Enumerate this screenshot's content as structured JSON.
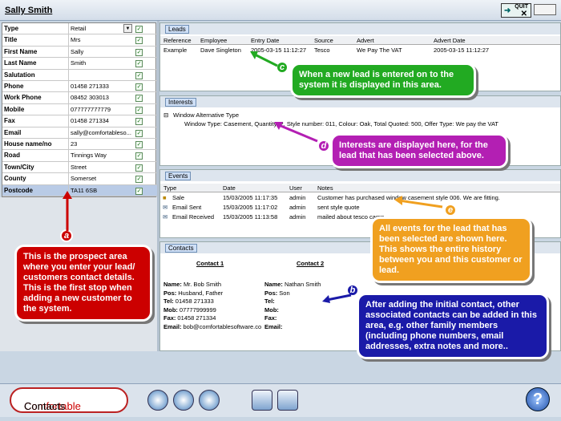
{
  "window": {
    "title": "Sally Smith",
    "quit_label": "QUIT"
  },
  "prospect": {
    "rows": [
      {
        "label": "Type",
        "value": "Retail",
        "dropdown": true
      },
      {
        "label": "Title",
        "value": "Mrs"
      },
      {
        "label": "First Name",
        "value": "Sally"
      },
      {
        "label": "Last Name",
        "value": "Smith"
      },
      {
        "label": "Salutation",
        "value": ""
      },
      {
        "label": "Phone",
        "value": "01458 271333"
      },
      {
        "label": "Work Phone",
        "value": "08452 303013"
      },
      {
        "label": "Mobile",
        "value": "077777777779"
      },
      {
        "label": "Fax",
        "value": "01458 271334"
      },
      {
        "label": "Email",
        "value": "sally@comfortableso..."
      },
      {
        "label": "House name/no",
        "value": "23"
      },
      {
        "label": "Road",
        "value": "Tinnings Way"
      },
      {
        "label": "Town/City",
        "value": "Street"
      },
      {
        "label": "County",
        "value": "Somerset"
      },
      {
        "label": "Postcode",
        "value": "TA11 6SB"
      }
    ]
  },
  "leads": {
    "tab": "Leads",
    "columns": [
      "Reference",
      "Employee",
      "Entry Date",
      "Source",
      "Advert",
      "Advert Date"
    ],
    "rows": [
      [
        "Example",
        "Dave Singleton",
        "2005-03-15 11:12:27",
        "Tesco",
        "We Pay The VAT",
        "2005-03-15 11:12:27"
      ]
    ]
  },
  "interests": {
    "tab": "Interests",
    "root": "Window Alternative Type",
    "child": "Window Type: Casement, Quantity: 2, Style number: 011, Colour: Oak, Total Quoted: 500, Offer Type: We pay the VAT"
  },
  "events": {
    "tab": "Events",
    "columns": [
      "Type",
      "Date",
      "User",
      "Notes"
    ],
    "rows": [
      [
        "Sale",
        "15/03/2005 11:17:35",
        "admin",
        "Customer has purchased window casement style 006. We are fitting."
      ],
      [
        "Email Sent",
        "15/03/2005 11:17:02",
        "admin",
        "sent style quote"
      ],
      [
        "Email Received",
        "15/03/2005 11:13:58",
        "admin",
        "mailed about tesco camp"
      ]
    ]
  },
  "contacts": {
    "tab": "Contacts",
    "contact1": {
      "heading": "Contact 1",
      "rows": [
        [
          "Name:",
          "Mr. Bob Smith"
        ],
        [
          "Pos:",
          "Husband, Father"
        ],
        [
          "Tel:",
          "01458 271333"
        ],
        [
          "Mob:",
          "07777999999"
        ],
        [
          "Fax:",
          "01458 271334"
        ],
        [
          "Email:",
          "bob@comfortablesoftware.co"
        ]
      ]
    },
    "contact2": {
      "heading": "Contact 2",
      "rows": [
        [
          "Name:",
          "Nathan Smith"
        ],
        [
          "Pos:",
          "Son"
        ],
        [
          "Tel:",
          ""
        ],
        [
          "Mob:",
          ""
        ],
        [
          "Fax:",
          ""
        ],
        [
          "Email:",
          ""
        ]
      ]
    }
  },
  "footer": {
    "logo_part1": "Comfortable",
    "logo_part2": "Contacts",
    "help_label": "?"
  },
  "callouts": {
    "a": {
      "badge": "a",
      "text": "This is the prospect area where you enter your lead/ customers contact details. This is the first stop when adding a new customer to the system."
    },
    "b": {
      "badge": "b",
      "text": "After adding the initial contact, other associated contacts can be added in this area, e.g. other family members (including phone numbers, email addresses, extra notes and more.."
    },
    "c": {
      "badge": "c",
      "text": "When a new lead is entered on to the system it is displayed in this area."
    },
    "d": {
      "badge": "d",
      "text": "Interests are displayed here, for the lead that has been selected above."
    },
    "e": {
      "badge": "e",
      "text": "All events for the lead that has been selected are shown here. This shows the entire history between you and this customer or lead."
    }
  },
  "colors": {
    "callout_red": "#cc0000",
    "callout_blue": "#1a1aa8",
    "callout_green": "#22aa22",
    "callout_magenta": "#b31fb3",
    "callout_orange": "#f0a020"
  }
}
